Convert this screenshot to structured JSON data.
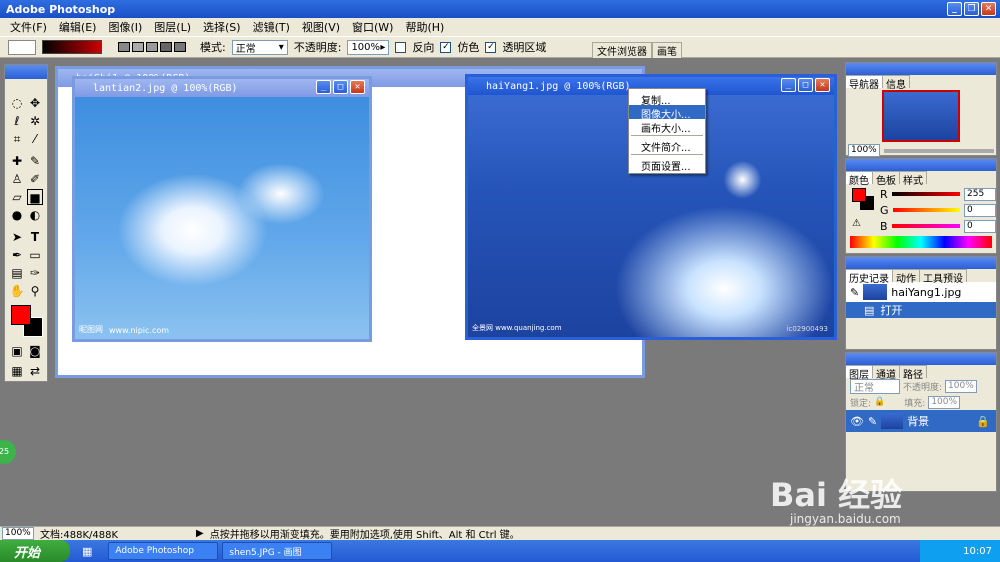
{
  "app": {
    "title": "Adobe Photoshop"
  },
  "menu": [
    "文件(F)",
    "编辑(E)",
    "图像(I)",
    "图层(L)",
    "选择(S)",
    "滤镜(T)",
    "视图(V)",
    "窗口(W)",
    "帮助(H)"
  ],
  "options": {
    "mode_label": "模式:",
    "mode_value": "正常",
    "opacity_label": "不透明度:",
    "opacity_value": "100%",
    "reverse_label": "反向",
    "dither_label": "仿色",
    "transparency_label": "透明区域"
  },
  "palette_tabs": [
    "文件浏览器",
    "画笔"
  ],
  "documents": {
    "back": {
      "title": "haiShi1 @ 100%(RGB)"
    },
    "lantian": {
      "title": "lantian2.jpg @ 100%(RGB)",
      "footer_left": "昵图网",
      "footer_right": "www.nipic.com"
    },
    "haiyang": {
      "title": "haiYang1.jpg @ 100%(RGB)",
      "footer_left": "全景网 www.quanjing.com",
      "footer_right": "ic02900493"
    }
  },
  "context_menu": [
    "复制...",
    "图像大小...",
    "画布大小...",
    "文件简介...",
    "页面设置..."
  ],
  "navigator": {
    "tabs": [
      "导航器",
      "信息"
    ],
    "zoom": "100%"
  },
  "color_panel": {
    "tabs": [
      "颜色",
      "色板",
      "样式"
    ],
    "r_label": "R",
    "g_label": "G",
    "b_label": "B",
    "r": "255",
    "g": "0",
    "b": "0",
    "fg": "#ff0000",
    "bg": "#000000"
  },
  "history": {
    "tabs": [
      "历史记录",
      "动作",
      "工具预设"
    ],
    "snapshot": "haiYang1.jpg",
    "step": "打开"
  },
  "layers": {
    "tabs": [
      "图层",
      "通道",
      "路径"
    ],
    "blend": "正常",
    "opacity_label": "不透明度:",
    "opacity": "100%",
    "lock_label": "锁定:",
    "fill_label": "填充:",
    "fill": "100%",
    "layer_name": "背景"
  },
  "status": {
    "zoom": "100%",
    "doc_size": "文档:488K/488K",
    "hint": "点按并拖移以用渐变填充。要用附加选项,使用 Shift、Alt 和 Ctrl 键。"
  },
  "taskbar": {
    "start": "开始",
    "tasks": [
      "Adobe Photoshop",
      "shen5.JPG - 画图"
    ],
    "clock": "10:07"
  },
  "side_badge": "25",
  "watermark": {
    "main": "Bai 经验",
    "sub": "jingyan.baidu.com"
  }
}
